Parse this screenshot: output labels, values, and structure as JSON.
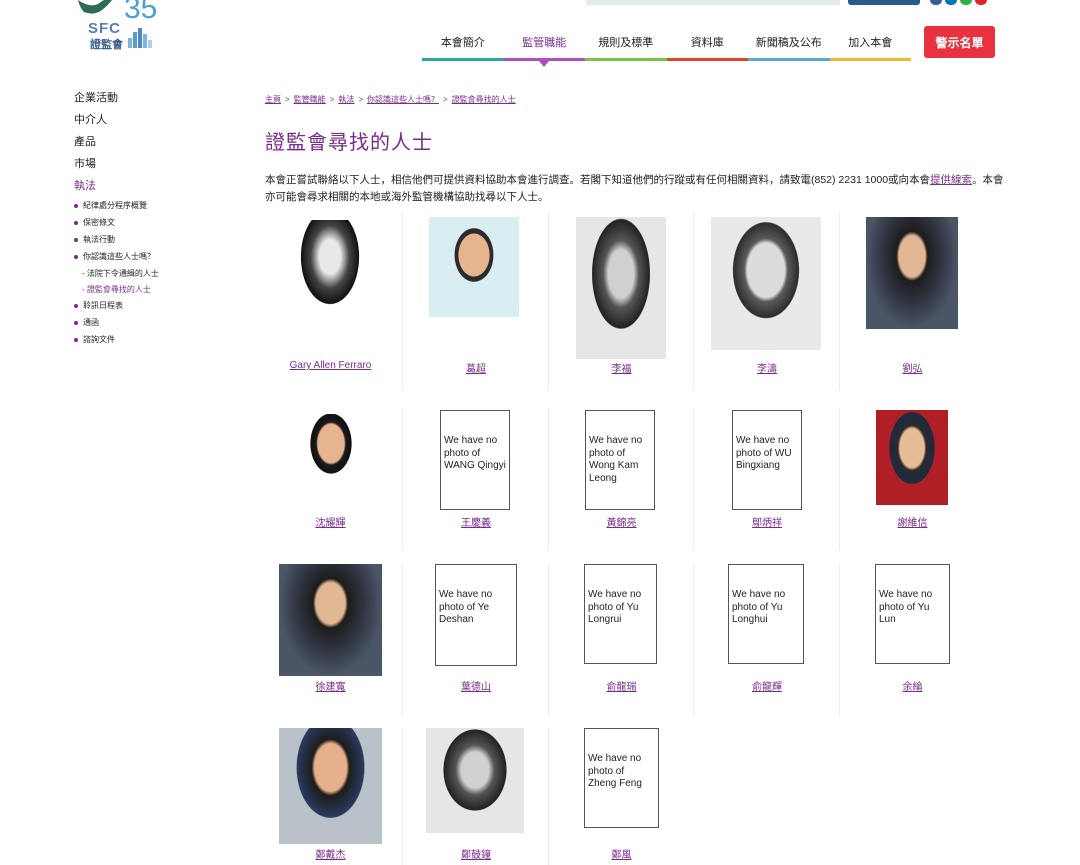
{
  "header": {
    "logo_text": "SFC",
    "logo_number": "35",
    "logo_cn": "證監會",
    "nav": [
      {
        "label": "本會簡介",
        "color": "#2aa79b",
        "active": false
      },
      {
        "label": "監管職能",
        "color": "#b04fc0",
        "active": true
      },
      {
        "label": "規則及標準",
        "color": "#7dc242",
        "active": false
      },
      {
        "label": "資料庫",
        "color": "#e0452b",
        "active": false
      },
      {
        "label": "新聞稿及公布",
        "color": "#5aa7d8",
        "active": false
      },
      {
        "label": "加入本會",
        "color": "#f2b632",
        "active": false
      }
    ],
    "alert_button": "警示名單"
  },
  "sidebar": {
    "items": [
      {
        "label": "企業活動",
        "level": 1
      },
      {
        "label": "中介人",
        "level": 1
      },
      {
        "label": "產品",
        "level": 1
      },
      {
        "label": "市場",
        "level": 1
      },
      {
        "label": "執法",
        "level": 1,
        "active": true
      },
      {
        "label": "紀律處分程序概覽",
        "level": 2
      },
      {
        "label": "保密條文",
        "level": 2
      },
      {
        "label": "執法行動",
        "level": 2
      },
      {
        "label": "你認識這些人士嗎？",
        "level": 2
      },
      {
        "label": "- 法院下令通緝的人士",
        "level": 3
      },
      {
        "label": "- 證監會尋找的人士",
        "level": 3,
        "active": true
      },
      {
        "label": "聆訊日程表",
        "level": 2
      },
      {
        "label": "通函",
        "level": 2
      },
      {
        "label": "諮詢文件",
        "level": 2
      }
    ]
  },
  "breadcrumb": [
    "主頁",
    "監管職能",
    "執法",
    "你認識這些人士嗎？",
    "證監會尋找的人士"
  ],
  "title": "證監會尋找的人士",
  "intro": {
    "text_before_link": "本會正嘗試聯絡以下人士，相信他們可提供資料協助本會進行調查。若閣下知道他們的行蹤或有任何相關資料，請致電(852) 2231 1000或向本會",
    "link": "提供線索",
    "text_after_link": "。本會亦可能會尋求相關的本地或海外監管機構協助找尋以下人士。"
  },
  "people": [
    {
      "name": "Gary Allen Ferraro",
      "photo": "bw-sketch"
    },
    {
      "name": "葛超",
      "photo": "color"
    },
    {
      "name": "李福",
      "photo": "bw-scan"
    },
    {
      "name": "李濤",
      "photo": "gray"
    },
    {
      "name": "劉弘",
      "photo": "color-dark"
    },
    {
      "name": "沈耀輝",
      "photo": "color-white"
    },
    {
      "name": "王慶義",
      "photo": "none",
      "nophoto_text": "We have no photo of WANG Qingyi"
    },
    {
      "name": "黃錦亮",
      "photo": "none",
      "nophoto_text": "We have no photo of Wong Kam Leong"
    },
    {
      "name": "鄔炳祥",
      "photo": "none",
      "nophoto_text": "We have no photo of WU Bingxiang"
    },
    {
      "name": "謝維信",
      "photo": "color-red"
    },
    {
      "name": "徐建寬",
      "photo": "color-dark"
    },
    {
      "name": "葉德山",
      "photo": "none",
      "nophoto_text": "We have no photo of Ye Deshan"
    },
    {
      "name": "俞龍瑞",
      "photo": "none",
      "nophoto_text": "We have no photo of Yu Longrui"
    },
    {
      "name": "俞龍輝",
      "photo": "none",
      "nophoto_text": "We have no photo of Yu Longhui"
    },
    {
      "name": "余綸",
      "photo": "none",
      "nophoto_text": "We have no photo of Yu Lun"
    },
    {
      "name": "鄭戴杰",
      "photo": "color-light"
    },
    {
      "name": "鄭鼓鐘",
      "photo": "bw-scan"
    },
    {
      "name": "鄭風",
      "photo": "none",
      "nophoto_text": "We have no photo of Zheng Feng"
    }
  ]
}
